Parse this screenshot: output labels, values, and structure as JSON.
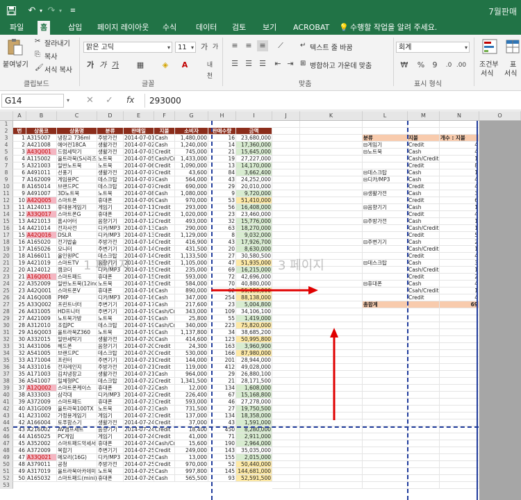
{
  "window": {
    "title": "7월판매"
  },
  "tabs": [
    "파일",
    "홈",
    "삽입",
    "페이지 레이아웃",
    "수식",
    "데이터",
    "검토",
    "보기",
    "ACROBAT"
  ],
  "active_tab": "홈",
  "tell_me": "수행할 작업을 알려 주세요.",
  "ribbon": {
    "clipboard": {
      "paste": "붙여넣기",
      "cut": "잘라내기",
      "copy": "복사",
      "format_painter": "서식 복사",
      "label": "클립보드"
    },
    "font": {
      "name": "맑은 고딕",
      "size": "11",
      "bold": "가",
      "italic": "가",
      "underline": "가",
      "label": "글꼴"
    },
    "alignment": {
      "wrap_text": "텍스트 줄 바꿈",
      "merge_center": "병합하고 가운데 맞춤",
      "label": "맞춤"
    },
    "number": {
      "format": "회계",
      "percent": "%",
      "comma": "9",
      "label": "표시 형식"
    },
    "styles": {
      "conditional": "조건부",
      "conditional2": "서식",
      "table": "표",
      "table2": "서식"
    }
  },
  "formula_bar": {
    "name_box": "G14",
    "cancel": "✕",
    "enter": "✓",
    "fx": "fx",
    "value": "293000"
  },
  "column_headers": [
    "A",
    "B",
    "C",
    "D",
    "E",
    "F",
    "G",
    "H",
    "I",
    "J",
    "K",
    "L",
    "M",
    "N",
    "O"
  ],
  "table_headers": [
    "번",
    "상품코",
    "상품명",
    "분류",
    "판매일",
    "지불",
    "소비자",
    "판매수량",
    "금액"
  ],
  "rows": [
    [
      "1",
      "A315007",
      "냉장고 736ml",
      "주방가전",
      "2014-07-01",
      "Cash",
      "1,480,000",
      "16",
      "23,680,000"
    ],
    [
      "2",
      "A421008",
      "에어컨18CA",
      "생활가전",
      "2014-07-02",
      "Cash",
      "1,240,000",
      "14",
      "17,360,000"
    ],
    [
      "3",
      "A43Q001",
      "드럼세탁기",
      "생활가전",
      "2014-07-03",
      "Credit",
      "745,000",
      "21",
      "15,645,000"
    ],
    [
      "4",
      "A115002",
      "울트라북(S시리즈)",
      "노트북",
      "2014-07-05",
      "Cash/Credit",
      "1,433,000",
      "19",
      "27,227,000"
    ],
    [
      "5",
      "A321003",
      "일반노트북",
      "노트북",
      "2014-07-06",
      "Credit",
      "1,090,000",
      "13",
      "14,170,000"
    ],
    [
      "6",
      "A491011",
      "선풍기",
      "생활가전",
      "2014-07-07",
      "Credit",
      "43,600",
      "84",
      "3,662,400"
    ],
    [
      "7",
      "A162009",
      "게임용PC",
      "데스크탑",
      "2014-07-07",
      "Cash",
      "564,000",
      "43",
      "24,252,000"
    ],
    [
      "8",
      "A165014",
      "브랜드PC",
      "데스크탑",
      "2014-07-07",
      "Credit",
      "690,000",
      "29",
      "20,010,000"
    ],
    [
      "9",
      "A491007",
      "3D노트북",
      "노트북",
      "2014-07-08",
      "Cash",
      "1,080,000",
      "9",
      "9,720,000"
    ],
    [
      "10",
      "A42Q005",
      "스마트폰",
      "휴대폰",
      "2014-07-09",
      "Cash",
      "970,000",
      "53",
      "51,410,000"
    ],
    [
      "11",
      "A124013",
      "휴대용게임기",
      "게임기",
      "2014-07-11",
      "Credit",
      "293,000",
      "56",
      "16,408,000"
    ],
    [
      "12",
      "A33Q017",
      "스마트폰G",
      "휴대폰",
      "2014-07-12",
      "Credit",
      "1,020,000",
      "23",
      "23,460,000"
    ],
    [
      "13",
      "A421013",
      "홈시어터",
      "음향기기",
      "2014-07-12",
      "Credit",
      "493,000",
      "32",
      "15,776,000"
    ],
    [
      "14",
      "A421014",
      "전자사전",
      "디카/MP3",
      "2014-07-13",
      "Cash",
      "290,000",
      "63",
      "18,270,000"
    ],
    [
      "15",
      "A42Q016",
      "DSLR",
      "디카/MP3",
      "2014-07-13",
      "Credit",
      "1,129,000",
      "8",
      "9,032,000"
    ],
    [
      "16",
      "A165020",
      "전기밥솥",
      "주방가전",
      "2014-07-14",
      "Credit",
      "416,900",
      "43",
      "17,926,700"
    ],
    [
      "17",
      "A165026",
      "모니터",
      "주변기기",
      "2014-07-14",
      "Credit",
      "431,500",
      "20",
      "8,630,000"
    ],
    [
      "18",
      "A166011",
      "올인원PC",
      "데스크탑",
      "2014-07-14",
      "Credit",
      "1,133,500",
      "27",
      "30,580,500"
    ],
    [
      "19",
      "A421019",
      "스마트TV",
      "음향기기",
      "2014-07-15",
      "Credit",
      "1,105,000",
      "47",
      "51,935,000"
    ],
    [
      "20",
      "A124012",
      "캠코더",
      "디카/MP3",
      "2014-07-15",
      "Credit",
      "235,000",
      "69",
      "16,215,000"
    ],
    [
      "21",
      "A16Q001",
      "스마트패드",
      "휴대폰",
      "2014-07-15",
      "Credit",
      "593,000",
      "72",
      "42,696,000"
    ],
    [
      "22",
      "A352009",
      "일반노트북(12inch)",
      "노트북",
      "2014-07-15",
      "Credit",
      "584,000",
      "70",
      "40,880,000"
    ],
    [
      "23",
      "A42Q001",
      "스마트폰V",
      "휴대폰",
      "2014-07-16",
      "Cash",
      "890,000",
      "62",
      "55,180,000"
    ],
    [
      "24",
      "A16Q008",
      "PMP",
      "디카/MP3",
      "2014-07-16",
      "Cash",
      "347,000",
      "254",
      "88,138,000"
    ],
    [
      "25",
      "A33Q002",
      "프린트너터",
      "주변기기",
      "2014-07-17",
      "Cash",
      "217,600",
      "23",
      "5,004,800"
    ],
    [
      "26",
      "A431005",
      "HD프니터",
      "주변기기",
      "2014-07-19",
      "Cash/Credit",
      "343,000",
      "109",
      "34,106,100"
    ],
    [
      "27",
      "A421009",
      "노트북가방",
      "노트북",
      "2014-07-19",
      "Cash",
      "25,800",
      "55",
      "1,419,000"
    ],
    [
      "28",
      "A312010",
      "조립PC",
      "데스크탑",
      "2014-07-19",
      "Cash/Credit",
      "340,000",
      "223",
      "75,820,000"
    ],
    [
      "29",
      "A16Q003",
      "울트라북Z360",
      "노트북",
      "2014-07-19",
      "Cash",
      "1,137,800",
      "34",
      "38,685,200"
    ],
    [
      "30",
      "A332015",
      "일반세탁기",
      "생활가전",
      "2014-07-20",
      "Cash",
      "414,600",
      "123",
      "50,995,800"
    ],
    [
      "31",
      "A431006",
      "헤드폰",
      "음향기기",
      "2014-07-20",
      "Credit",
      "24,300",
      "163",
      "3,960,900"
    ],
    [
      "32",
      "A541005",
      "브랜드PC",
      "데스크탑",
      "2014-07-20",
      "Credit",
      "530,000",
      "166",
      "87,980,000"
    ],
    [
      "33",
      "A171004",
      "프린터",
      "주변기기",
      "2014-07-21",
      "Credit",
      "144,000",
      "201",
      "28,944,000"
    ],
    [
      "34",
      "A331016",
      "전자레인지",
      "주방가전",
      "2014-07-21",
      "Credit",
      "119,000",
      "412",
      "49,028,000"
    ],
    [
      "35",
      "A171003",
      "김치냉장고",
      "생활가전",
      "2014-07-21",
      "Cash",
      "964,000",
      "29",
      "26,880,100"
    ],
    [
      "36",
      "A541007",
      "일체형PC",
      "데스크탑",
      "2014-07-22",
      "Credit",
      "1,341,500",
      "21",
      "28,171,500"
    ],
    [
      "37",
      "A12Q002",
      "스마트폰케이스",
      "휴대폰",
      "2014-07-22",
      "Cash",
      "12,000",
      "134",
      "1,608,000"
    ],
    [
      "38",
      "A333003",
      "삼각대",
      "디카/MP3",
      "2014-07-22",
      "Credit",
      "226,400",
      "67",
      "15,168,800"
    ],
    [
      "39",
      "A372009",
      "스마트패드",
      "휴대폰",
      "2014-07-23",
      "Credit",
      "593,000",
      "46",
      "27,278,000"
    ],
    [
      "40",
      "A31G009",
      "울트라북100TX",
      "노트북",
      "2014-07-23",
      "Cash",
      "731,500",
      "27",
      "19,750,500"
    ],
    [
      "41",
      "A231002",
      "가정용게임기",
      "게임기",
      "2014-07-23",
      "Credit",
      "137,000",
      "134",
      "18,358,000"
    ],
    [
      "42",
      "A166004",
      "토푸함스기",
      "생활가전",
      "2014-07-24",
      "Credit",
      "37,000",
      "43",
      "1,591,000"
    ],
    [
      "43",
      "A216002",
      "AV앰프세트",
      "음향기기",
      "2014-07-24",
      "Credit",
      "18,400",
      "450",
      "8,280,000"
    ],
    [
      "44",
      "A165025",
      "PC게임",
      "게임기",
      "2014-07-24",
      "Credit",
      "41,000",
      "71",
      "2,911,000"
    ],
    [
      "45",
      "A352002",
      "스마트패드악세서리",
      "휴대폰",
      "2014-07-24",
      "Cash/Credit",
      "15,600",
      "190",
      "2,964,000"
    ],
    [
      "46",
      "A372009",
      "복합기",
      "주변기기",
      "2014-07-25",
      "Credit",
      "249,000",
      "143",
      "35,035,000"
    ],
    [
      "47",
      "A33Q021",
      "메모리(16G)",
      "디카/MP3",
      "2014-07-25",
      "Cash",
      "13,000",
      "155",
      "2,015,000"
    ],
    [
      "48",
      "A379011",
      "공청",
      "주방가전",
      "2014-07-25",
      "Credit",
      "970,000",
      "52",
      "50,440,000"
    ],
    [
      "49",
      "A317019",
      "울트라북아카데미",
      "노트북",
      "2014-07-25",
      "Cash",
      "997,800",
      "145",
      "144,681,000"
    ],
    [
      "50",
      "A165032",
      "스마트패드(mini)",
      "휴대폰",
      "2014-07-26",
      "Cash",
      "565,500",
      "93",
      "52,591,500"
    ]
  ],
  "pivot": {
    "headers": [
      "분류",
      "지불",
      "개수 : 지불"
    ],
    "rows": [
      [
        "⊟게임기",
        "Credit",
        "4"
      ],
      [
        "⊟노트북",
        "Cash",
        "4"
      ],
      [
        "",
        "Cash/Credit",
        "1"
      ],
      [
        "",
        "Credit",
        "8"
      ],
      [
        "⊟데스크탑",
        "Cash",
        "1"
      ],
      [
        "⊟디카/MP3",
        "Cash",
        "4"
      ],
      [
        "",
        "Credit",
        "4"
      ],
      [
        "⊟생활가전",
        "Cash",
        "3"
      ],
      [
        "",
        "Credit",
        "6"
      ],
      [
        "⊟음향기기",
        "Cash",
        "1"
      ],
      [
        "",
        "Credit",
        "4"
      ],
      [
        "⊟주방가전",
        "Cash",
        "1"
      ],
      [
        "",
        "Cash/Credit",
        "1"
      ],
      [
        "",
        "Credit",
        "5"
      ],
      [
        "⊟주변기기",
        "Cash",
        "2"
      ],
      [
        "",
        "Cash/Credit",
        "1"
      ],
      [
        "",
        "Credit",
        "4"
      ],
      [
        "⊟데스크탑",
        "Cash",
        "3"
      ],
      [
        "",
        "Cash/Credit",
        "1"
      ],
      [
        "",
        "Credit",
        "2"
      ],
      [
        "⊟휴대폰",
        "Cash",
        "4"
      ],
      [
        "",
        "Csah/Credit",
        "1"
      ],
      [
        "",
        "Credit",
        "4"
      ]
    ],
    "total_label": "총합계",
    "total_value": "69"
  },
  "watermarks": [
    "1 페이지",
    "3 페이지"
  ],
  "colors": {
    "excel_green": "#217346",
    "header_red": "#8b2d1b",
    "pivot_header": "#f8cbad",
    "page_break_blue": "#1f3b9c",
    "arrow_red": "#e00000"
  },
  "icons": [
    "save-icon",
    "undo-icon",
    "redo-icon",
    "customize-icon",
    "lightbulb-icon"
  ]
}
